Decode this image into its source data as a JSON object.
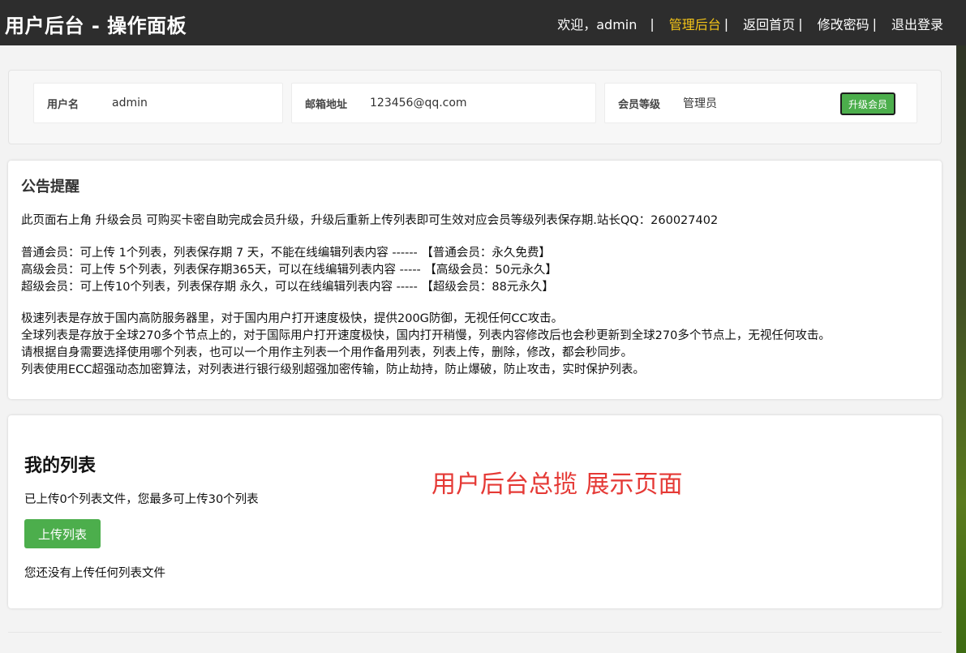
{
  "header": {
    "title": "用户后台 - 操作面板",
    "welcome": "欢迎，admin",
    "separator": "|",
    "nav": [
      {
        "label": "管理后台"
      },
      {
        "label": "返回首页"
      },
      {
        "label": "修改密码"
      },
      {
        "label": "退出登录"
      }
    ],
    "pipe": "|"
  },
  "account": {
    "username_label": "用户名",
    "username": "admin",
    "email_label": "邮箱地址",
    "email": "123456@qq.com",
    "level_label": "会员等级",
    "level": "管理员",
    "upgrade_label": "升级会员"
  },
  "notice": {
    "title": "公告提醒",
    "intro": "此页面右上角 升级会员 可购买卡密自助完成会员升级，升级后重新上传列表即可生效对应会员等级列表保存期.站长QQ：260027402",
    "tiers": [
      "普通会员：可上传 1个列表，列表保存期 7 天，不能在线编辑列表内容 ------ 【普通会员：永久免费】",
      "高级会员：可上传 5个列表，列表保存期365天，可以在线编辑列表内容 ----- 【高级会员：50元永久】",
      "超级会员：可上传10个列表，列表保存期 永久，可以在线编辑列表内容 ----- 【超级会员：88元永久】"
    ],
    "details": [
      "极速列表是存放于国内高防服务器里，对于国内用户打开速度极快，提供200G防御，无视任何CC攻击。",
      "全球列表是存放于全球270多个节点上的，对于国际用户打开速度极快，国内打开稍慢，列表内容修改后也会秒更新到全球270多个节点上，无视任何攻击。",
      "请根据自身需要选择使用哪个列表，也可以一个用作主列表一个用作备用列表，列表上传，删除，修改，都会秒同步。",
      "列表使用ECC超强动态加密算法，对列表进行银行级别超强加密传输，防止劫持，防止爆破，防止攻击，实时保护列表。"
    ]
  },
  "my_list": {
    "title": "我的列表",
    "summary": "已上传0个列表文件，您最多可上传30个列表",
    "upload_label": "上传列表",
    "empty_note": "您还没有上传任何列表文件",
    "caption": "用户后台总揽 展示页面"
  },
  "colors": {
    "header_bg": "#2d2d2d",
    "active_nav": "#f5c518",
    "button_green": "#4cae4c",
    "caption_red": "#e53935"
  }
}
